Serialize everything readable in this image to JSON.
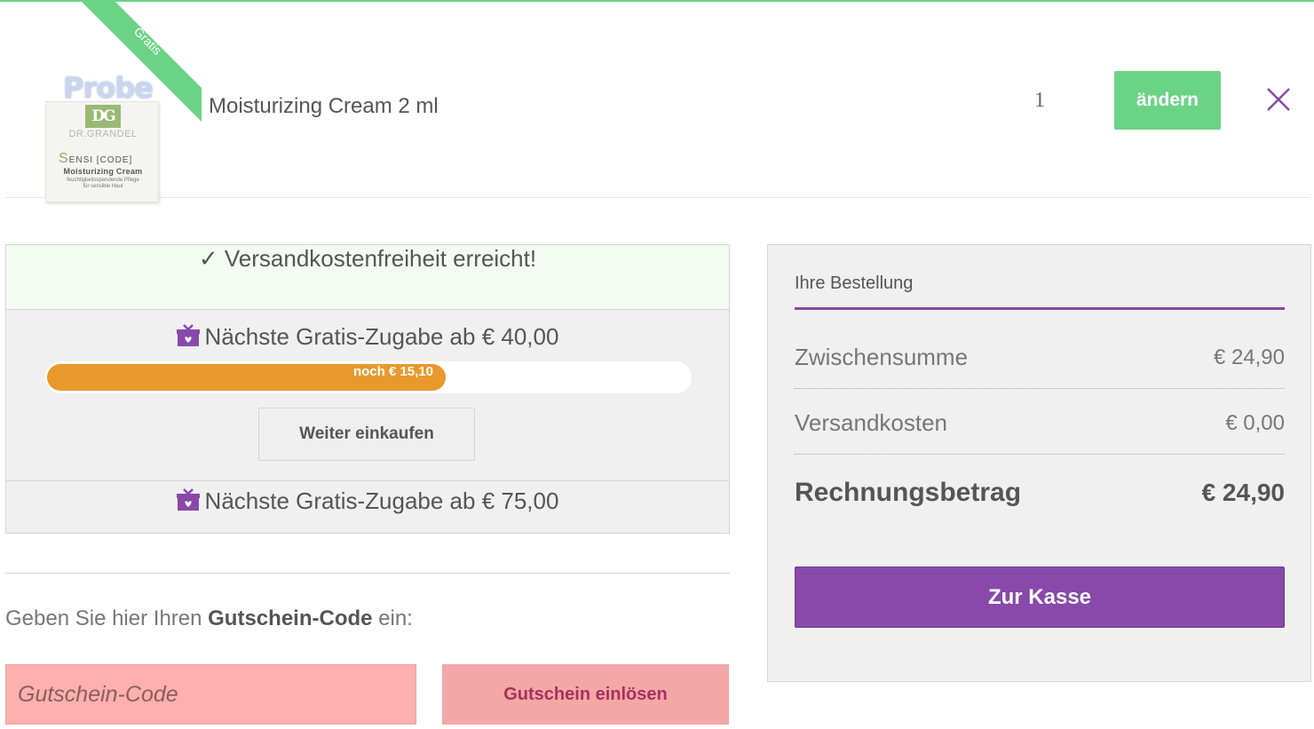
{
  "cart_item": {
    "image_overlay_text": "Probe",
    "image_brand": "DR.GRANDEL",
    "image_product_line": "ENSI [CODE]",
    "image_product_name": "Moisturizing Cream",
    "image_product_desc_1": "feuchtigkeitsspendende Pflege",
    "image_product_desc_2": "für sensible Haut",
    "ribbon": "Gratis",
    "name": "Moisturizing Cream 2 ml",
    "quantity": "1",
    "change_label": "ändern",
    "remove_icon": "close-icon"
  },
  "promo": {
    "success_text": "✓ Versandkostenfreiheit erreicht!",
    "gift_1": "Nächste Gratis-Zugabe ab € 40,00",
    "progress_label": "noch € 15,10",
    "progress_fraction": 0.62,
    "continue_label": "Weiter einkaufen",
    "gift_2": "Nächste Gratis-Zugabe ab € 75,00",
    "gift_icon": "gift-icon"
  },
  "coupon": {
    "prompt_prefix": "Geben Sie hier Ihren ",
    "prompt_bold": "Gutschein-Code",
    "prompt_suffix": " ein:",
    "placeholder": "Gutschein-Code",
    "button_label": "Gutschein einlösen"
  },
  "summary": {
    "title": "Ihre Bestellung",
    "subtotal_label": "Zwischensumme",
    "subtotal_value": "€ 24,90",
    "shipping_label": "Versandkosten",
    "shipping_value": "€ 0,00",
    "total_label": "Rechnungsbetrag",
    "total_value": "€ 24,90",
    "checkout_label": "Zur Kasse"
  },
  "colors": {
    "accent_green": "#6bd385",
    "accent_purple": "#8849aa",
    "progress_orange": "#e8992c",
    "coupon_pink": "#fdb0ae"
  }
}
